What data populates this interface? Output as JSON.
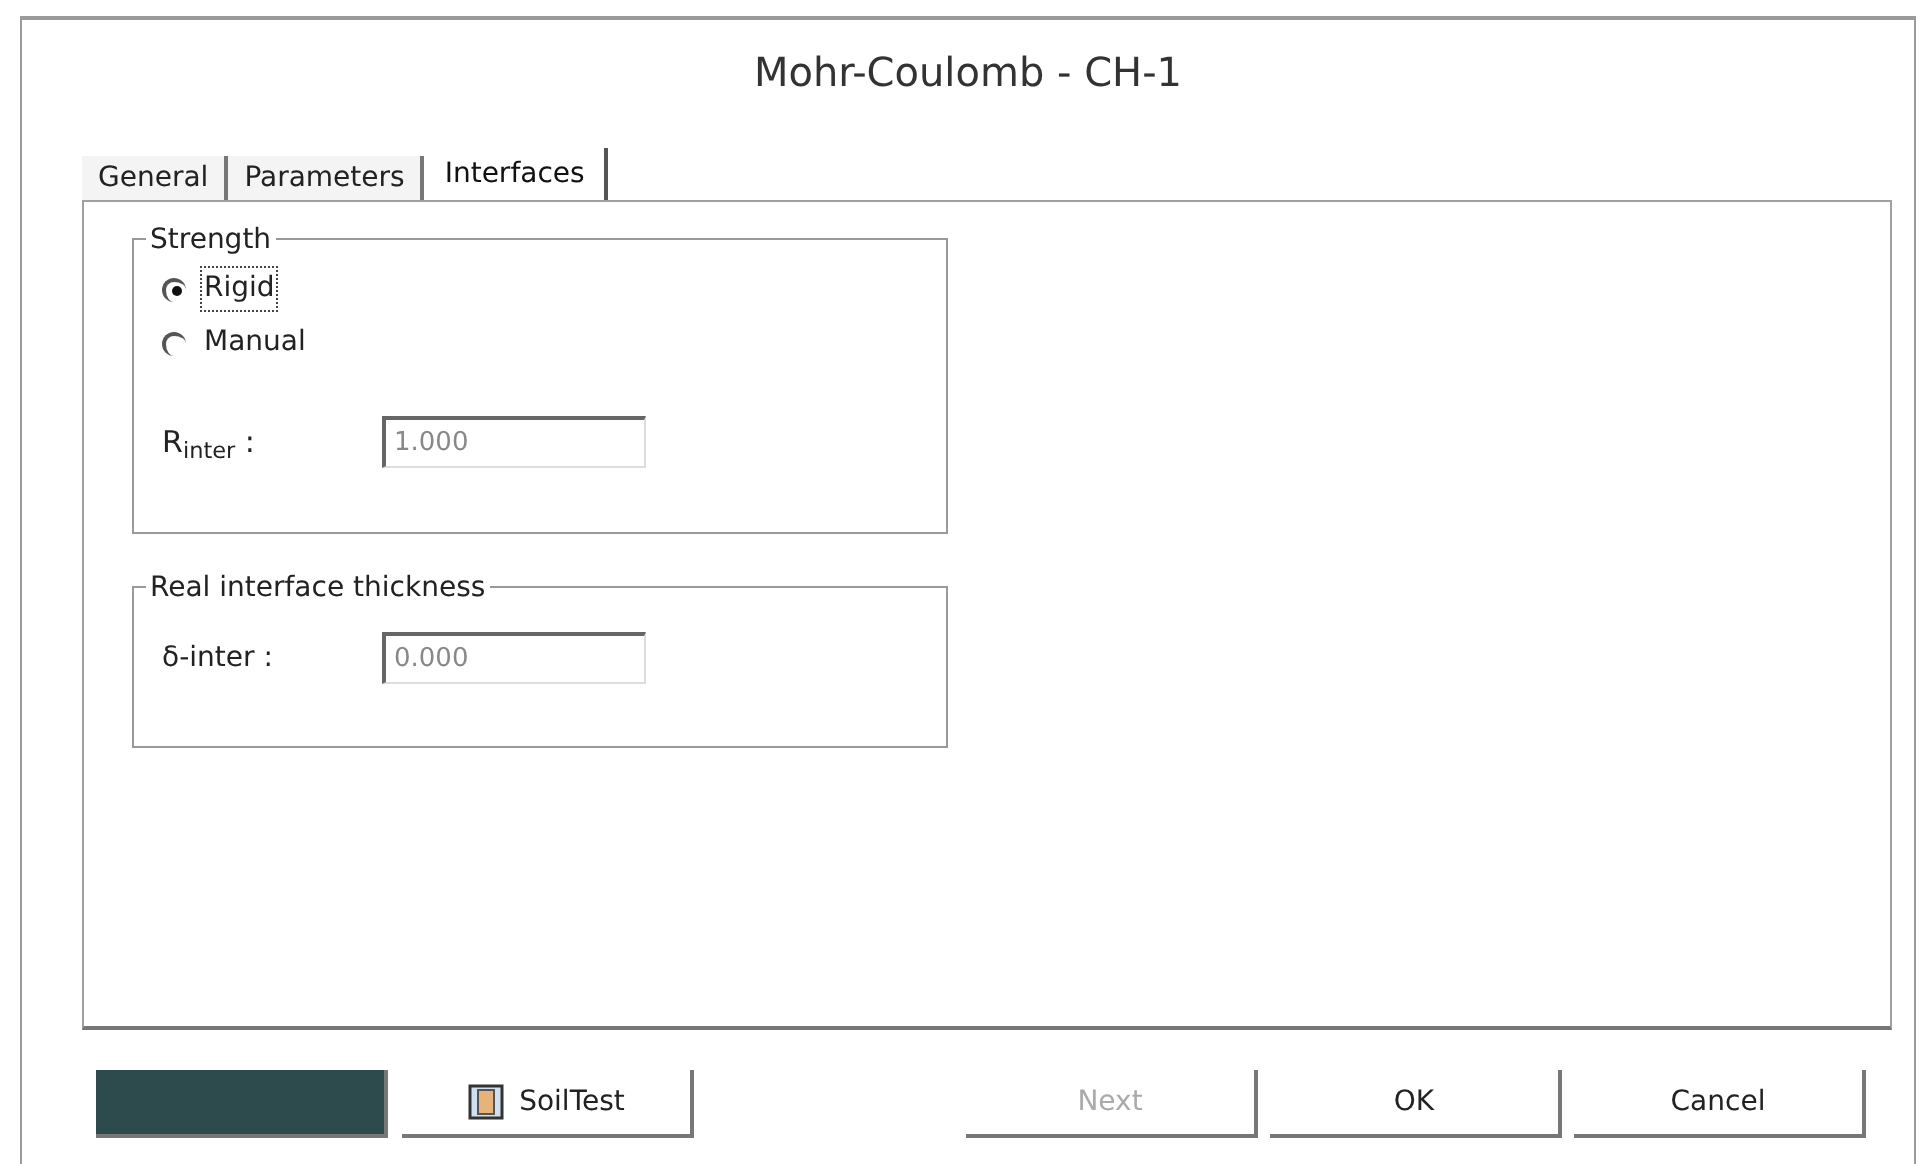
{
  "window": {
    "title": "Mohr-Coulomb - CH-1"
  },
  "tabs": [
    {
      "label": "General",
      "selected": false
    },
    {
      "label": "Parameters",
      "selected": false
    },
    {
      "label": "Interfaces",
      "selected": true
    }
  ],
  "strength": {
    "title": "Strength",
    "options": [
      {
        "label": "Rigid",
        "selected": true
      },
      {
        "label": "Manual",
        "selected": false
      }
    ],
    "field": {
      "label": "R$_{inter}$ :",
      "value": "1.000"
    }
  },
  "thickness": {
    "title": "Real interface thickness",
    "field": {
      "label": "δ-inter :",
      "value": "0.000"
    }
  },
  "left_buttons": [
    {
      "kind": "blank"
    },
    {
      "kind": "icon",
      "label": "SoilTest"
    }
  ],
  "right_buttons": [
    {
      "label": "Next",
      "disabled": true
    },
    {
      "label": "OK",
      "disabled": false
    },
    {
      "label": "Cancel",
      "disabled": false
    }
  ]
}
